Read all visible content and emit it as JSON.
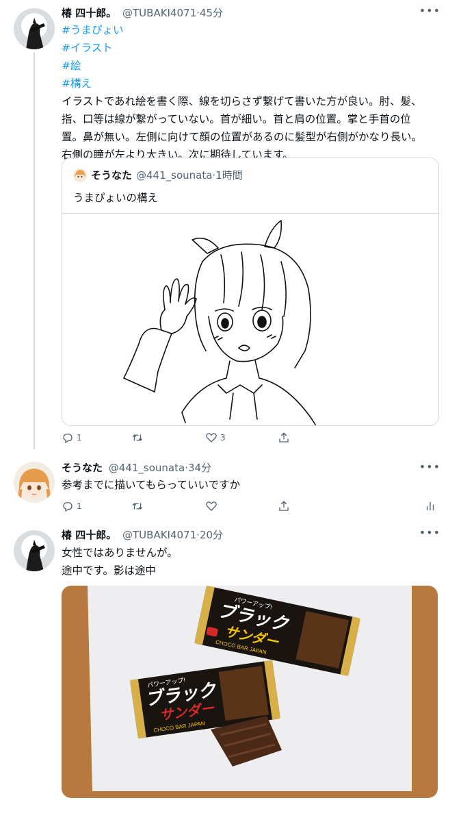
{
  "tweets": [
    {
      "name": "椿 四十郎。",
      "handle": "@TUBAKI4071",
      "dot": "·",
      "time": "45分",
      "hashtags": [
        "#うまぴょい",
        "#イラスト",
        "#絵",
        "#構え"
      ],
      "body": [
        "イラストであれ絵を書く際、線を切らさず繋げて書いた方が良い。肘、髪、",
        "指、口等は線が繋がっていない。首が細い。首と肩の位置。掌と手首の位",
        "置。鼻が無い。左側に向けて顔の位置があるのに髪型が右側がかなり長い。",
        "右側の瞳が左より大きい。次に期待しています。"
      ],
      "quote": {
        "name": "そうなた",
        "handle": "@441_sounata",
        "dot": "·",
        "time": "1時間",
        "text": "うまぴょいの構え"
      },
      "reply_count": "1",
      "retweet_count": "",
      "like_count": "3"
    },
    {
      "name": "そうなた",
      "handle": "@441_sounata",
      "dot": "·",
      "time": "34分",
      "body": [
        "参考までに描いてもらっていいですか"
      ],
      "reply_count": "1",
      "retweet_count": "",
      "like_count": ""
    },
    {
      "name": "椿 四十郎。",
      "handle": "@TUBAKI4071",
      "dot": "·",
      "time": "20分",
      "body": [
        "女性ではありませんが。",
        "途中です。影は途中"
      ],
      "candy": {
        "top_text": "パワーアップ!",
        "title": "ブラック",
        "subtitle": "サンダー",
        "bottom_text": "CHOCO BAR JAPAN"
      }
    }
  ],
  "more_glyph": "•••",
  "colors": {
    "link": "#1d9bf0",
    "muted": "#536471",
    "border": "#cfd9de"
  }
}
